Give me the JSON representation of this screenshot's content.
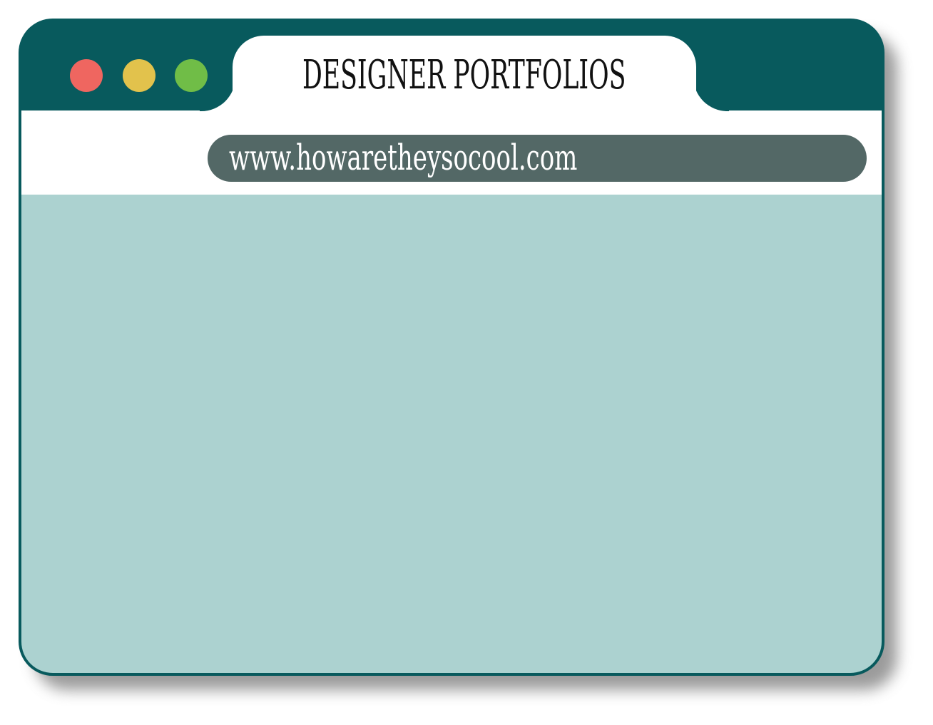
{
  "window": {
    "title": "DESIGNER PORTFOLIOS",
    "url": "www.howaretheysocool.com",
    "controls": [
      {
        "name": "close",
        "color": "#ef6660"
      },
      {
        "name": "minimize",
        "color": "#e2c24c"
      },
      {
        "name": "maximize",
        "color": "#70bd47"
      }
    ]
  },
  "colors": {
    "frame": "#085a5d",
    "content": "#acd2d0",
    "url_bar": "#536866"
  }
}
